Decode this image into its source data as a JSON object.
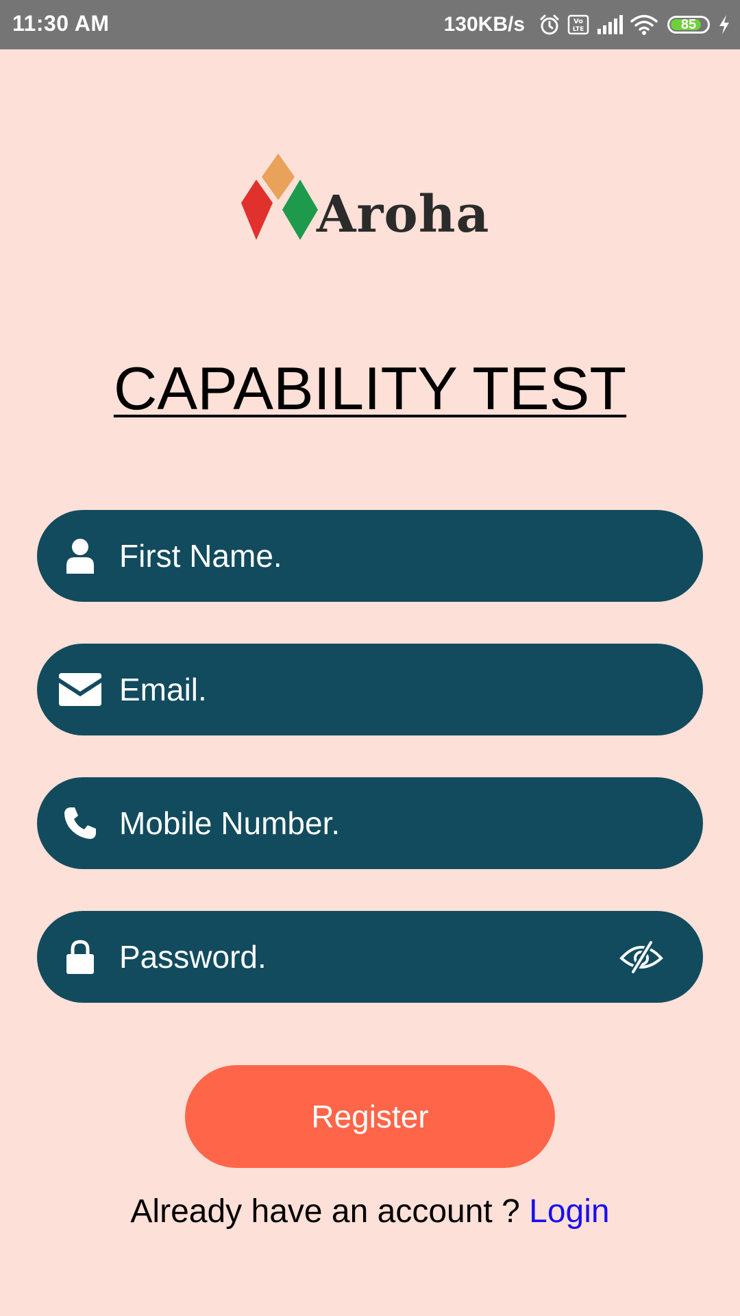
{
  "status_bar": {
    "time": "11:30 AM",
    "network_speed": "130KB/s",
    "battery_level": "85",
    "battery_fraction": 0.85,
    "icons": [
      "alarm-icon",
      "volte-icon",
      "signal-icon",
      "wifi-icon",
      "battery-icon",
      "charging-icon"
    ]
  },
  "logo": {
    "text": "Aroha",
    "colors": {
      "top_diamond": "#e8a25a",
      "left_diamond": "#e0312d",
      "right_diamond": "#1d9a4b"
    }
  },
  "title": "CAPABILITY TEST",
  "form": {
    "first_name": {
      "placeholder": "First Name.",
      "icon": "person-icon"
    },
    "email": {
      "placeholder": "Email.",
      "icon": "envelope-icon"
    },
    "mobile": {
      "placeholder": "Mobile Number.",
      "icon": "phone-icon"
    },
    "password": {
      "placeholder": "Password.",
      "icon": "lock-icon",
      "toggle_icon": "eye-off-icon"
    }
  },
  "register_label": "Register",
  "login_prompt": {
    "text": "Already have an account ? ",
    "link": "Login"
  },
  "colors": {
    "background": "#fde0d7",
    "field": "#124b5e",
    "button": "#ff6548",
    "link": "#1a0ef0"
  }
}
